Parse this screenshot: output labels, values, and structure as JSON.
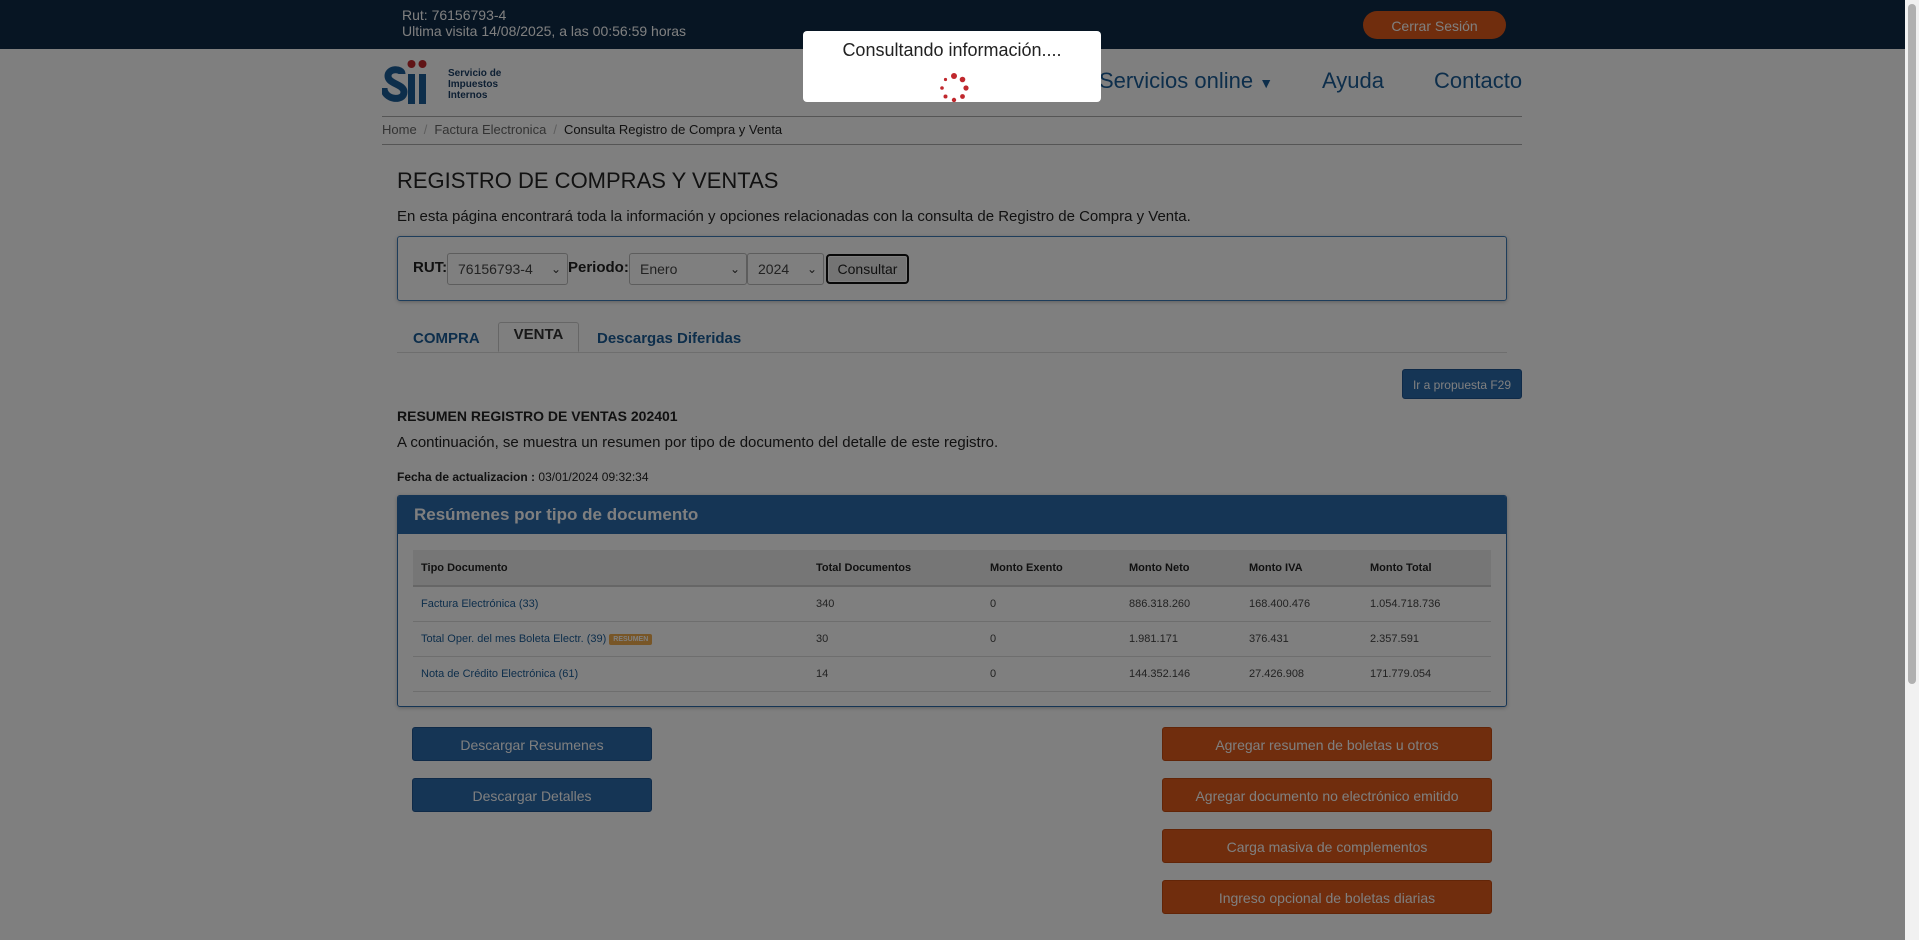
{
  "header": {
    "rut_line": "Rut: 76156793-4",
    "last_visit": "Ultima visita 14/08/2025, a las 00:56:59 horas",
    "logout_label": "Cerrar Sesión"
  },
  "logo": {
    "line1": "Servicio de",
    "line2": "Impuestos",
    "line3": "Internos"
  },
  "nav": {
    "servicios": "Servicios online",
    "ayuda": "Ayuda",
    "contacto": "Contacto"
  },
  "breadcrumb": [
    "Home",
    "Factura Electronica",
    "Consulta Registro de Compra y Venta"
  ],
  "page": {
    "title": "REGISTRO DE COMPRAS Y VENTAS",
    "intro": "En esta página encontrará toda la información y opciones relacionadas con la consulta de Registro de Compra y Venta."
  },
  "filter": {
    "rut_label": "RUT:",
    "rut_value": "76156793-4",
    "periodo_label": "Periodo:",
    "month_value": "Enero",
    "year_value": "2024",
    "consultar_label": "Consultar"
  },
  "tabs": [
    "COMPRA",
    "VENTA",
    "Descargas Diferidas"
  ],
  "f29_label": "Ir a propuesta F29",
  "summary": {
    "heading": "RESUMEN REGISTRO DE VENTAS 202401",
    "description": "A continuación, se muestra un resumen por tipo de documento del detalle de este registro.",
    "fecha_label": "Fecha de actualizacion :",
    "fecha_value": "03/01/2024 09:32:34"
  },
  "panel": {
    "title": "Resúmenes por tipo de documento",
    "columns": [
      "Tipo Documento",
      "Total Documentos",
      "Monto Exento",
      "Monto Neto",
      "Monto IVA",
      "Monto Total"
    ],
    "badge": "RESUMEN",
    "rows": [
      [
        "Factura Electrónica (33)",
        "340",
        "0",
        "886.318.260",
        "168.400.476",
        "1.054.718.736"
      ],
      [
        "Total Oper. del mes Boleta Electr. (39)",
        "30",
        "0",
        "1.981.171",
        "376.431",
        "2.357.591"
      ],
      [
        "Nota de Crédito Electrónica (61)",
        "14",
        "0",
        "144.352.146",
        "27.426.908",
        "171.779.054"
      ]
    ]
  },
  "actions": {
    "descargar_resumenes": "Descargar Resumenes",
    "descargar_detalles": "Descargar Detalles",
    "agregar_resumen": "Agregar resumen de boletas u otros",
    "agregar_documento": "Agregar documento no electrónico emitido",
    "carga_masiva": "Carga masiva de complementos",
    "ingreso_opcional": "Ingreso opcional de boletas diarias"
  },
  "modal": {
    "message": "Consultando información...."
  },
  "colors": {
    "topbar": "#0e2a47",
    "primary": "#2b6aab",
    "accent": "#e05a1a",
    "spinner": "#c0282d"
  }
}
